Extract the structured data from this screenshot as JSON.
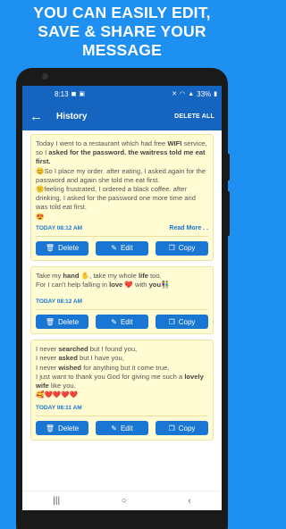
{
  "promo": {
    "line1": "YOU CAN EASILY EDIT,",
    "line2": "SAVE & SHARE YOUR",
    "line3": "MESSAGE"
  },
  "status": {
    "time": "8:13",
    "battery": "33%"
  },
  "appbar": {
    "title": "History",
    "delete_all": "DELETE ALL"
  },
  "cards": [
    {
      "timestamp": "TODAY 08:12 AM",
      "more": "Read More . .",
      "delete": "Delete",
      "edit": "Edit",
      "copy": "Copy"
    },
    {
      "timestamp": "TODAY 08:12 AM",
      "delete": "Delete",
      "edit": "Edit",
      "copy": "Copy"
    },
    {
      "timestamp": "TODAY 08:11 AM",
      "delete": "Delete",
      "edit": "Edit",
      "copy": "Copy"
    }
  ],
  "messages": {
    "m1_a": "Today I went to a restaurant which had free ",
    "m1_b": "WIFI",
    "m1_c": " service, so I ",
    "m1_d": "asked for the password. the waitress told me eat first.",
    "m1_e": "😊So I place my order. after eating, I asked again for the password and again she told me eat first.",
    "m1_f": "😕feeling frustrated,  I ordered a black coffee. after drinking, I asked for the password one more time and was told eat first.",
    "m1_g": "😍",
    "m2_a": "Take my ",
    "m2_b": "hand",
    "m2_c": " ✋, take my whole ",
    "m2_d": "life",
    "m2_e": " too.",
    "m2_f": "For I can't help falling in ",
    "m2_g": "love",
    "m2_h": " ❤️ with ",
    "m2_i": "you",
    "m2_j": "👫",
    "m3_a": "I never ",
    "m3_b": "searched",
    "m3_c": " but I found you,",
    "m3_d": "I never ",
    "m3_e": "asked",
    "m3_f": " but I have you,",
    "m3_g": "I never ",
    "m3_h": "wished",
    "m3_i": " for anything but it come true,",
    "m3_j": "I just want to thank you God for giving me such a ",
    "m3_k": "lovely wife",
    "m3_l": " like you.",
    "m3_m": "🥰❤️❤️❤️❤️"
  },
  "icons": {
    "back": "arrow-left-icon",
    "delete": "trash-icon",
    "edit": "pencil-icon",
    "copy": "copy-icon",
    "nav_recent": "recents-icon",
    "nav_home": "home-icon",
    "nav_back": "nav-back-icon"
  },
  "colors": {
    "background": "#1e90f2",
    "appbar": "#1565c0",
    "card": "#fffbd2",
    "button": "#1976d2"
  }
}
